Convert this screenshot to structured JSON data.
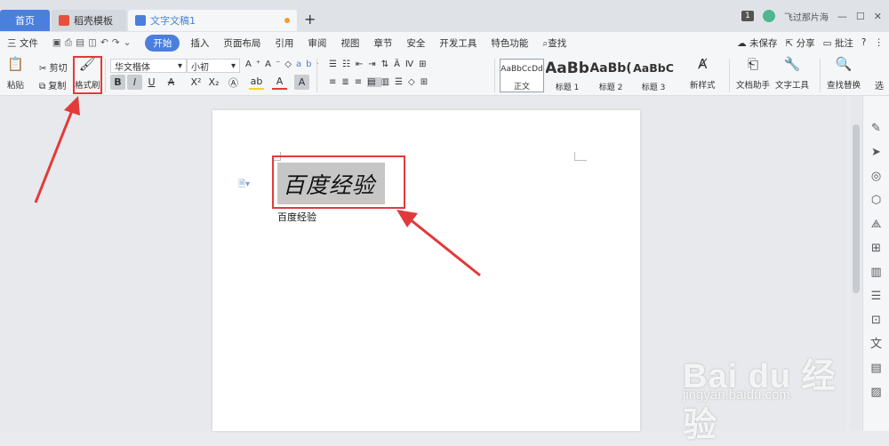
{
  "tabs": {
    "home": "首页",
    "template": "稻壳模板",
    "document": "文字文稿1",
    "new_tab": "+"
  },
  "titlebar": {
    "count": "1",
    "user": "飞过那片海"
  },
  "menu": {
    "file": "三 文件",
    "items": [
      "开始",
      "插入",
      "页面布局",
      "引用",
      "审阅",
      "视图",
      "章节",
      "安全",
      "开发工具",
      "特色功能",
      "查找"
    ],
    "right": [
      "未保存",
      "分享",
      "批注",
      "?",
      "⋮"
    ]
  },
  "toolbar": {
    "paste": "粘贴",
    "cut": "剪切",
    "copy": "复制",
    "format_painter": "格式刷",
    "font_name": "华文楷体",
    "font_size": "小初",
    "styles": [
      {
        "sample": "AaBbCcDd",
        "name": "正文"
      },
      {
        "sample": "AaBb",
        "name": "标题 1"
      },
      {
        "sample": "AaBb(",
        "name": "标题 2"
      },
      {
        "sample": "AaBbC",
        "name": "标题 3"
      }
    ],
    "new_style": "新样式",
    "doc_helper": "文档助手",
    "text_tools": "文字工具",
    "find_replace": "查找替换",
    "select": "选"
  },
  "document": {
    "heading": "百度经验",
    "body": "百度经验"
  },
  "watermark": {
    "logo": "Bai du 经验",
    "url": "jingyan.baidu.com"
  },
  "colors": {
    "accent": "#4a7fde",
    "annotation_red": "#e23a3a",
    "selection_gray": "#c6c6c6"
  }
}
